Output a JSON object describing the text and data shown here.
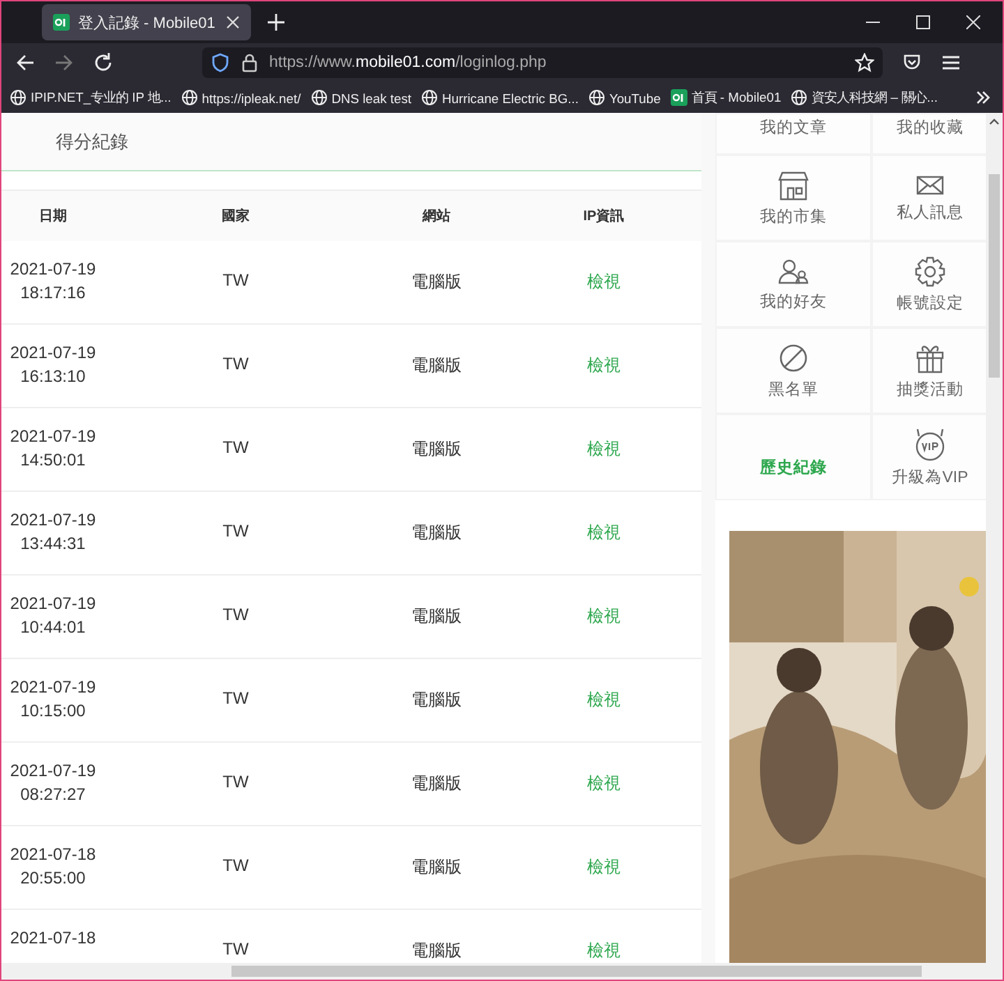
{
  "browser": {
    "tab": {
      "title": "登入記錄 - Mobile01"
    },
    "url": {
      "prefix": "https://www.",
      "domain": "mobile01.com",
      "path": "/loginlog.php"
    },
    "bookmarks": [
      {
        "label": "IPIP.NET_专业的 IP 地...",
        "kind": "globe"
      },
      {
        "label": "https://ipleak.net/",
        "kind": "globe"
      },
      {
        "label": "DNS leak test",
        "kind": "globe"
      },
      {
        "label": "Hurricane Electric BG...",
        "kind": "globe"
      },
      {
        "label": "YouTube",
        "kind": "globe"
      },
      {
        "label": "首頁 - Mobile01",
        "kind": "m01"
      },
      {
        "label": "資安人科技網 – 關心...",
        "kind": "globe"
      }
    ]
  },
  "section": {
    "title": "得分紀錄"
  },
  "table": {
    "columns": [
      "日期",
      "國家",
      "網站",
      "IP資訊"
    ],
    "rows": [
      {
        "date": "2021-07-19",
        "time": "18:17:16",
        "country": "TW",
        "site": "電腦版",
        "ip": "檢視"
      },
      {
        "date": "2021-07-19",
        "time": "16:13:10",
        "country": "TW",
        "site": "電腦版",
        "ip": "檢視"
      },
      {
        "date": "2021-07-19",
        "time": "14:50:01",
        "country": "TW",
        "site": "電腦版",
        "ip": "檢視"
      },
      {
        "date": "2021-07-19",
        "time": "13:44:31",
        "country": "TW",
        "site": "電腦版",
        "ip": "檢視"
      },
      {
        "date": "2021-07-19",
        "time": "10:44:01",
        "country": "TW",
        "site": "電腦版",
        "ip": "檢視"
      },
      {
        "date": "2021-07-19",
        "time": "10:15:00",
        "country": "TW",
        "site": "電腦版",
        "ip": "檢視"
      },
      {
        "date": "2021-07-19",
        "time": "08:27:27",
        "country": "TW",
        "site": "電腦版",
        "ip": "檢視"
      },
      {
        "date": "2021-07-18",
        "time": "20:55:00",
        "country": "TW",
        "site": "電腦版",
        "ip": "檢視"
      },
      {
        "date": "2021-07-18",
        "country": "TW",
        "site": "電腦版",
        "ip": "檢視"
      }
    ]
  },
  "sidebar": {
    "items": [
      {
        "label": "我的文章",
        "kind": "text",
        "selected": false
      },
      {
        "label": "我的收藏",
        "kind": "text",
        "selected": false
      },
      {
        "label": "我的市集",
        "kind": "store",
        "selected": false
      },
      {
        "label": "私人訊息",
        "kind": "mail",
        "selected": false
      },
      {
        "label": "我的好友",
        "kind": "friends",
        "selected": false
      },
      {
        "label": "帳號設定",
        "kind": "gear",
        "selected": false
      },
      {
        "label": "黑名單",
        "kind": "ban",
        "selected": false
      },
      {
        "label": "抽獎活動",
        "kind": "gift",
        "selected": false
      },
      {
        "label": "歷史紀錄",
        "kind": "text",
        "selected": true
      },
      {
        "label": "升級為VIP",
        "kind": "vip",
        "selected": false
      }
    ]
  }
}
